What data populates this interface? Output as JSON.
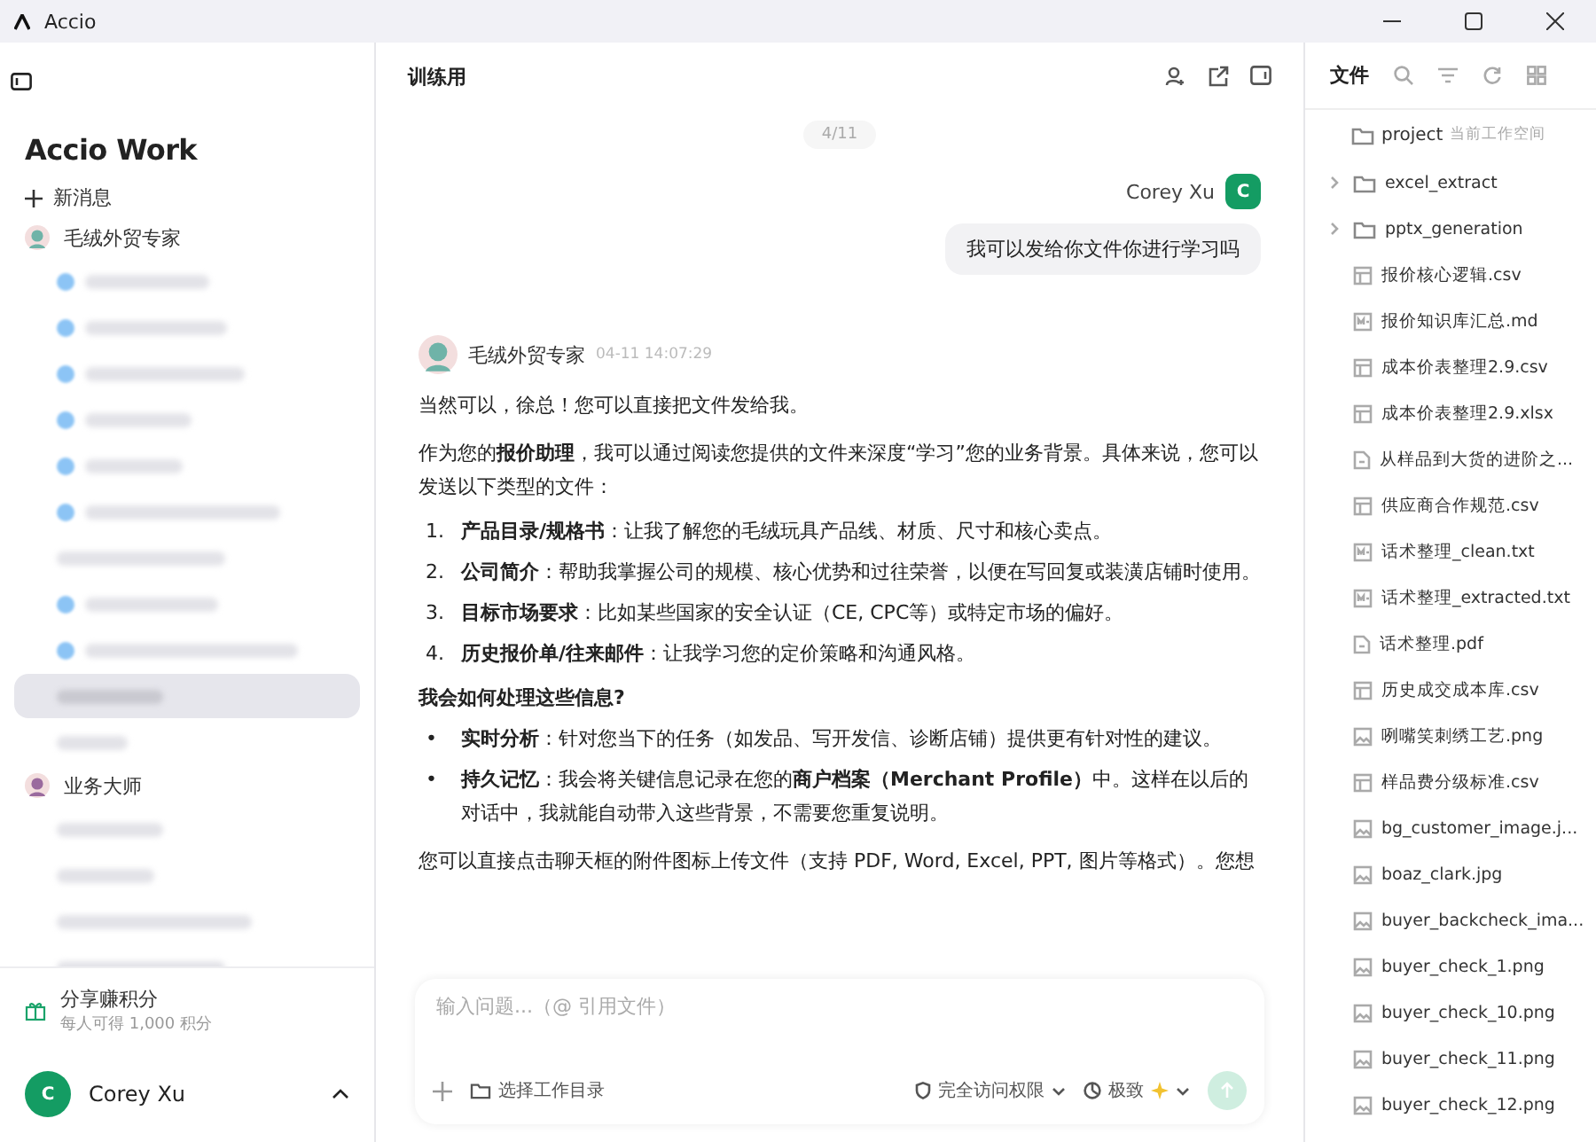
{
  "window": {
    "title": "Accio"
  },
  "sidebar": {
    "logo": "Accio Work",
    "new_chat": "新消息",
    "agents": [
      {
        "name": "毛绒外贸专家",
        "color": "#6fb3a8",
        "items": [
          {
            "kind": "blurred",
            "dot": true,
            "selected": false
          },
          {
            "kind": "blurred",
            "dot": true,
            "selected": false
          },
          {
            "kind": "blurred",
            "dot": true,
            "selected": false
          },
          {
            "kind": "blurred",
            "dot": true,
            "selected": false
          },
          {
            "kind": "blurred",
            "dot": true,
            "selected": false
          },
          {
            "kind": "blurred",
            "dot": true,
            "selected": false
          },
          {
            "kind": "blurred",
            "dot": false,
            "selected": false
          },
          {
            "kind": "blurred",
            "dot": true,
            "selected": false
          },
          {
            "kind": "blurred",
            "dot": true,
            "selected": false
          },
          {
            "kind": "blurred",
            "dot": false,
            "selected": true
          },
          {
            "kind": "blurred",
            "dot": false,
            "selected": false
          }
        ]
      },
      {
        "name": "业务大师",
        "color": "#9a6a9e",
        "items": [
          {
            "kind": "blurred",
            "dot": false,
            "selected": false
          },
          {
            "kind": "blurred",
            "dot": false,
            "selected": false
          },
          {
            "kind": "blurred",
            "dot": false,
            "selected": false
          },
          {
            "kind": "blurred",
            "dot": false,
            "selected": false
          }
        ]
      }
    ],
    "promo": {
      "title": "分享赚积分",
      "subtitle": "每人可得 1,000 积分"
    },
    "user": {
      "name": "Corey Xu",
      "initial": "C"
    }
  },
  "chat": {
    "title": "训练用",
    "counter": "4/11",
    "user_message": {
      "name": "Corey Xu",
      "initial": "C",
      "text": "我可以发给你文件你进行学习吗"
    },
    "reply": {
      "name": "毛绒外贸专家",
      "time": "04-11 14:07:29",
      "blocks": [
        {
          "kind": "para",
          "text": "当然可以，徐总！您可以直接把文件发给我。"
        },
        {
          "kind": "para",
          "text": "作为您的**报价助理**，我可以通过阅读您提供的文件来深度“学习”您的业务背景。具体来说，您可以发送以下类型的文件："
        },
        {
          "kind": "ol",
          "items": [
            {
              "marker": "1.",
              "text": "**产品目录/规格书**：让我了解您的毛绒玩具产品线、材质、尺寸和核心卖点。"
            },
            {
              "marker": "2.",
              "text": "**公司简介**：帮助我掌握公司的规模、核心优势和过往荣誉，以便在写回复或装潢店铺时使用。"
            },
            {
              "marker": "3.",
              "text": "**目标市场要求**：比如某些国家的安全认证（CE, CPC等）或特定市场的偏好。"
            },
            {
              "marker": "4.",
              "text": "**历史报价单/往来邮件**：让我学习您的定价策略和沟通风格。"
            }
          ]
        },
        {
          "kind": "heading",
          "text": "我会如何处理这些信息?"
        },
        {
          "kind": "ul",
          "items": [
            {
              "marker": "•",
              "text": "**实时分析**：针对您当下的任务（如发品、写开发信、诊断店铺）提供更有针对性的建议。"
            },
            {
              "marker": "•",
              "text": "**持久记忆**：我会将关键信息记录在您的**商户档案（Merchant Profile）**中。这样在以后的对话中，我就能自动带入这些背景，不需要您重复说明。"
            }
          ]
        },
        {
          "kind": "para",
          "text": "您可以直接点击聊天框的附件图标上传文件（支持 PDF, Word, Excel, PPT, 图片等格式）。您想"
        }
      ]
    },
    "composer": {
      "placeholder": "输入问题...（@ 引用文件）",
      "folder": "选择工作目录",
      "access": "完全访问权限",
      "mode": "极致",
      "send_disabled": true
    }
  },
  "files": {
    "title": "文件",
    "workspace": "project",
    "workspace_note": "当前工作空间",
    "items": [
      {
        "kind": "folder",
        "name": "excel_extract"
      },
      {
        "kind": "folder",
        "name": "pptx_generation"
      },
      {
        "kind": "sheet",
        "name": "报价核心逻辑.csv"
      },
      {
        "kind": "text",
        "name": "报价知识库汇总.md"
      },
      {
        "kind": "sheet",
        "name": "成本价表整理2.9.csv"
      },
      {
        "kind": "sheet",
        "name": "成本价表整理2.9.xlsx"
      },
      {
        "kind": "doc",
        "name": "从样品到大货的进阶之..."
      },
      {
        "kind": "sheet",
        "name": "供应商合作规范.csv"
      },
      {
        "kind": "text",
        "name": "话术整理_clean.txt"
      },
      {
        "kind": "text",
        "name": "话术整理_extracted.txt"
      },
      {
        "kind": "doc",
        "name": "话术整理.pdf"
      },
      {
        "kind": "sheet",
        "name": "历史成交成本库.csv"
      },
      {
        "kind": "image",
        "name": "咧嘴笑刺绣工艺.png"
      },
      {
        "kind": "sheet",
        "name": "样品费分级标准.csv"
      },
      {
        "kind": "image",
        "name": "bg_customer_image.j..."
      },
      {
        "kind": "image",
        "name": "boaz_clark.jpg"
      },
      {
        "kind": "image",
        "name": "buyer_backcheck_ima..."
      },
      {
        "kind": "image",
        "name": "buyer_check_1.png"
      },
      {
        "kind": "image",
        "name": "buyer_check_10.png"
      },
      {
        "kind": "image",
        "name": "buyer_check_11.png"
      },
      {
        "kind": "image",
        "name": "buyer_check_12.png"
      }
    ]
  }
}
